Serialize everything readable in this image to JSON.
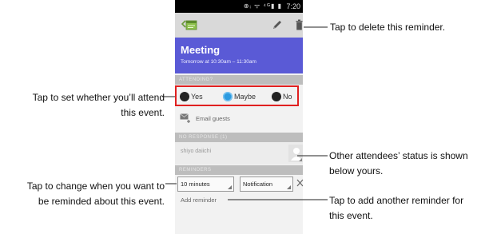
{
  "status_bar": {
    "icons": "⊕ᵢ ᯤ ⁴ᴳ▮ ▮",
    "time": "7:20"
  },
  "action_bar": {
    "app_icon": "calendar-back-icon",
    "edit_icon": "pencil-icon",
    "delete_icon": "trash-icon"
  },
  "event": {
    "title": "Meeting",
    "time": "Tomorrow at 10:30am – 11:30am",
    "header_color": "#5a5ad6"
  },
  "sections": {
    "attending": "ATTENDING?",
    "no_response": "NO RESPONSE (1)",
    "reminders": "REMINDERS"
  },
  "attend_options": [
    {
      "label": "Yes",
      "selected": false
    },
    {
      "label": "Maybe",
      "selected": true
    },
    {
      "label": "No",
      "selected": false
    }
  ],
  "email_guests": {
    "label": "Email guests",
    "icon": "envelope-plus-icon"
  },
  "attendee": {
    "name": "shiyo daiichi",
    "status_icon": "contact-status-icon"
  },
  "reminder": {
    "time": "10 minutes",
    "method": "Notification",
    "remove_icon": "close-icon",
    "add_label": "Add reminder"
  },
  "callouts": {
    "attend_line1": "Tap to set whether you’ll attend",
    "attend_line2": "this event.",
    "remind_line1": "Tap to change when you want to",
    "remind_line2": "be reminded about this event.",
    "delete": "Tap to delete this reminder.",
    "attendees_line1": "Other attendees’ status is shown",
    "attendees_line2": "below yours.",
    "add_line1": "Tap to add another reminder for",
    "add_line2": "this event."
  },
  "highlight_color": "#e02020"
}
